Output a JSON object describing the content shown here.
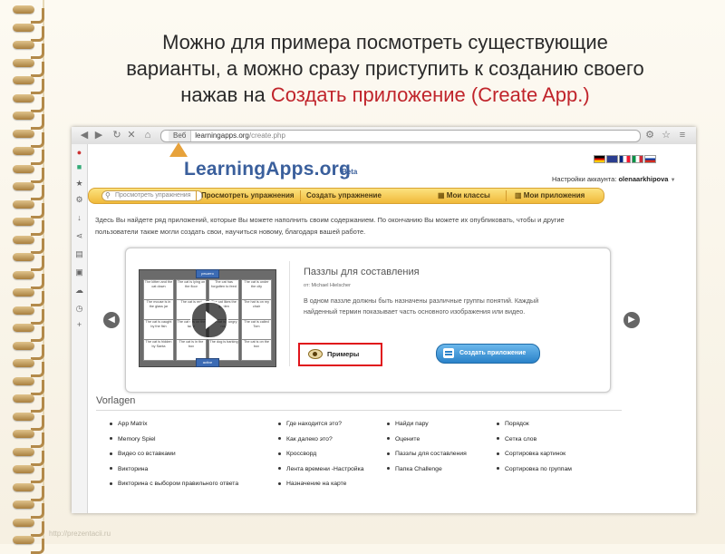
{
  "slide": {
    "heading_line1": "Можно для примера посмотреть существующие",
    "heading_line2": "варианты, а можно сразу приступить к созданию своего",
    "heading_prefix": "нажав на ",
    "heading_highlight": "Создать приложение (Create App.)",
    "footer_url": "http://prezentacii.ru"
  },
  "browser": {
    "address_tab": "Веб",
    "address_domain": "learningapps.org",
    "address_path": "/create.php"
  },
  "site": {
    "logo": "LearningApps.org",
    "beta": "Beta",
    "account_label": "Настройки аккаунта:",
    "account_user": "olenaarkhipova",
    "account_caret": "▼",
    "nav": {
      "search_placeholder": "Просмотреть упражнения",
      "browse": "Просмотреть упражнения",
      "create": "Создать упражнение",
      "classes": "Мои классы",
      "apps": "Мои приложения"
    },
    "intro_line1": "Здесь Вы найдете ряд приложений, которые Вы можете наполнить своим содержанием. По окончанию Вы можете их опубликовать, чтобы и другие",
    "intro_line2": "пользователи также могли создать свои, научиться новому, благодаря вашей работе."
  },
  "app_card": {
    "title": "Паззлы для составления",
    "author": "от: Michael Hielscher",
    "description": "В одном паззле должны быть назначены различные группы понятий. Каждый найденный термин показывает часть основного изображения или видео.",
    "examples_label": "Примеры",
    "create_label": "Создать приложение",
    "preview_tab_top": "решето",
    "preview_tab_bottom": "active",
    "preview_pieces": [
      "The kitten and the cat down",
      "The cat is lying on the floor",
      "The cat has forgotten to feed",
      "The cat is under the city",
      "The mouse is in the glass jar",
      "The cat is red",
      "The cat likes the garden",
      "The hat is on my chair",
      "The cat is caught by the fish",
      "The cat sits on the table",
      "The cat is hungry now",
      "The cat is called Tom",
      "The cat is hidden by Santa",
      "The cat is in the box",
      "The dog is barking",
      "The cat is on the box"
    ]
  },
  "vorlagen": {
    "title": "Vorlagen",
    "col1": [
      "App Matrix",
      "Memory Spiel",
      "Видео со вставками",
      "Викторина",
      "Викторина с выбором правильного ответа"
    ],
    "col2": [
      "Где находится это?",
      "Как далеко это?",
      "Кроссворд",
      "Лента времени -Настройка",
      "Назначение на карте"
    ],
    "col3": [
      "Найди пару",
      "Оцените",
      "Паззлы для составления",
      "Папка Challenge"
    ],
    "col4": [
      "Порядок",
      "Сетка слов",
      "Сортировка картинок",
      "Сортировка по группам"
    ]
  },
  "colors": {
    "highlight": "#c0242b",
    "nav_gold": "#f0b93a",
    "create_button_blue": "#2a82c9",
    "examples_border": "#e0141b"
  }
}
